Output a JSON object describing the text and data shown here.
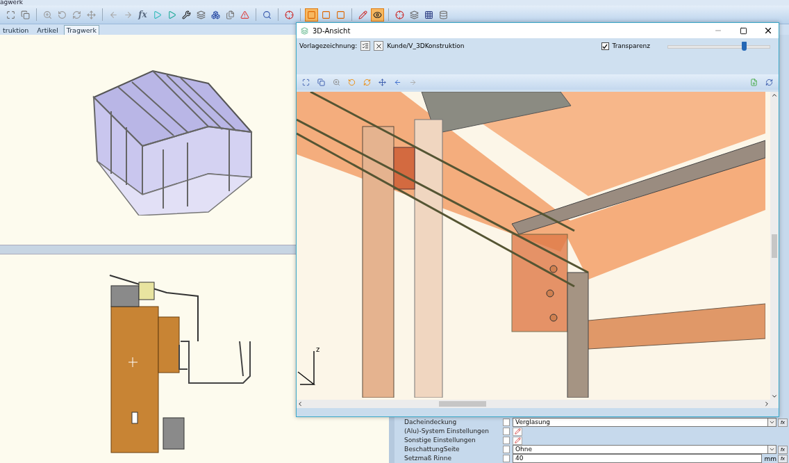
{
  "app": {
    "title": "agwerk"
  },
  "toolbar": [
    {
      "kind": "icon",
      "selected": false
    },
    {
      "kind": "icon",
      "selected": false
    },
    {
      "kind": "sep"
    },
    {
      "kind": "icon",
      "selected": false
    },
    {
      "kind": "icon",
      "selected": false
    },
    {
      "kind": "icon",
      "selected": false
    },
    {
      "kind": "icon",
      "selected": false
    },
    {
      "kind": "sep"
    },
    {
      "kind": "icon",
      "selected": false
    },
    {
      "kind": "icon",
      "selected": false
    },
    {
      "kind": "text",
      "label": "fx"
    },
    {
      "kind": "icon",
      "selected": false
    },
    {
      "kind": "icon",
      "selected": false
    },
    {
      "kind": "icon",
      "selected": false
    },
    {
      "kind": "icon",
      "selected": false
    },
    {
      "kind": "icon",
      "selected": false
    },
    {
      "kind": "icon",
      "selected": false
    },
    {
      "kind": "icon",
      "selected": false
    },
    {
      "kind": "sep"
    },
    {
      "kind": "icon",
      "selected": false
    },
    {
      "kind": "sep"
    },
    {
      "kind": "icon",
      "selected": false
    },
    {
      "kind": "sep"
    },
    {
      "kind": "icon",
      "selected": true
    },
    {
      "kind": "icon",
      "selected": false
    },
    {
      "kind": "icon",
      "selected": false
    },
    {
      "kind": "sep"
    },
    {
      "kind": "icon",
      "selected": false
    },
    {
      "kind": "icon",
      "selected": true
    },
    {
      "kind": "sep"
    },
    {
      "kind": "icon",
      "selected": false
    },
    {
      "kind": "icon",
      "selected": false
    },
    {
      "kind": "icon",
      "selected": false
    },
    {
      "kind": "icon",
      "selected": false
    }
  ],
  "tabs": [
    {
      "label": "truktion",
      "selected": false
    },
    {
      "label": "Artikel",
      "selected": false
    },
    {
      "label": "Tragwerk",
      "selected": true
    }
  ],
  "properties": [
    {
      "kind": "dropdown",
      "label": "Dacheindeckung",
      "checked": false,
      "value": "Verglasung",
      "formula": "fx"
    },
    {
      "kind": "edit",
      "label": "(Alu)-System Einstellungen",
      "checked": false
    },
    {
      "kind": "edit",
      "label": "Sonstige Einstellungen",
      "checked": false
    },
    {
      "kind": "dropdown",
      "label": "BeschattungSeite",
      "checked": false,
      "value": "Ohne",
      "formula": "fx"
    },
    {
      "kind": "number",
      "label": "Setzmaß Rinne",
      "checked": false,
      "value": "40",
      "unit": "mm",
      "formula": "fx"
    }
  ],
  "window": {
    "title": "3D-Ansicht",
    "template_label": "Vorlagezeichnung:",
    "template_value": "Kunde/V_3DKonstruktion",
    "transparency": {
      "label": "Transparenz",
      "checked": true,
      "level": 0.74
    },
    "axis_label": "z"
  }
}
